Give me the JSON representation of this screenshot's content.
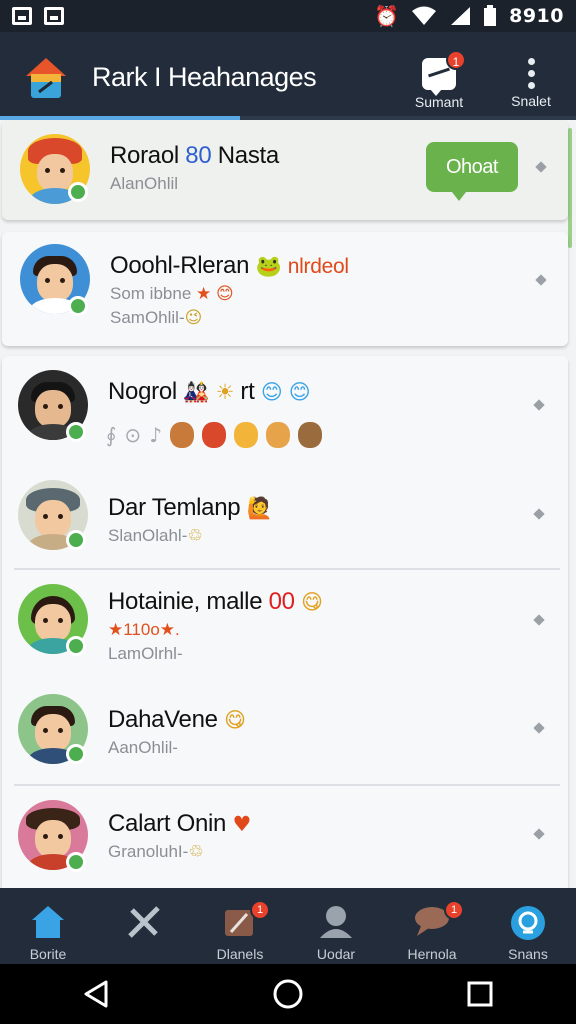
{
  "status_bar": {
    "time": "8910",
    "icons": [
      "image-icon",
      "picture-icon",
      "alarm-icon",
      "wifi-icon",
      "signal-icon",
      "battery-icon"
    ]
  },
  "app_bar": {
    "title": "Rark I Heahanages",
    "actions": [
      {
        "name": "summary",
        "label": "Sumant",
        "icon": "chat-compose-icon",
        "badge": "1"
      },
      {
        "name": "menu",
        "label": "Snalet",
        "icon": "kebab-menu-icon"
      }
    ]
  },
  "colors": {
    "app_bar": "#222c3a",
    "accent_blue": "#58a9e6",
    "online_green": "#4cae4f",
    "chat_button": "#6ab24c",
    "badge_red": "#e8412c"
  },
  "chat_button_label": "Ohoat",
  "contacts": [
    {
      "name": "Roraol",
      "name_accent": "80",
      "name_tail": "Nasta",
      "sub": "AlanOhlil",
      "highlighted": true
    },
    {
      "name": "Ooohl-Rleran",
      "name_emoji": "🐸",
      "name_accent": "nlrdeol",
      "sub": "Som ibbne",
      "sub_emoji": "★ 😊",
      "sub2": "SamOhlil-",
      "sub2_emoji": "😉"
    },
    {
      "name": "Nogrol",
      "name_emoji": "🎎 ☀",
      "name_tail": "rt",
      "name_emoji2": "😊 😊",
      "emoji_row": [
        "∮",
        "⊙",
        "♪"
      ]
    },
    {
      "name": "Dar Temlanp",
      "name_emoji": "🙋",
      "sub": "SlanOlahl-",
      "sub_emoji": "♲"
    },
    {
      "name": "Hotainie, malle",
      "name_accent": "00",
      "name_emoji": "😋",
      "sub_stars": "★110o★.",
      "sub": "LamOlrhl-"
    },
    {
      "name": "DahaVene",
      "name_emoji": "😋",
      "sub": "AanOhlil-"
    },
    {
      "name": "Calart Onin",
      "name_emoji": "♥",
      "sub": "GranoluhI-",
      "sub_emoji": "♲"
    }
  ],
  "bottom_nav": [
    {
      "label": "Borite",
      "icon": "home-icon",
      "active": true
    },
    {
      "label": "",
      "icon": "tools-icon"
    },
    {
      "label": "Dlanels",
      "icon": "panel-icon",
      "badge": "1"
    },
    {
      "label": "Uodar",
      "icon": "user-icon"
    },
    {
      "label": "Hernola",
      "icon": "chat-bubble-icon",
      "badge": "1"
    },
    {
      "label": "Snans",
      "icon": "status-icon"
    }
  ],
  "system_nav": [
    "back-icon",
    "home-circle-icon",
    "recents-icon"
  ]
}
